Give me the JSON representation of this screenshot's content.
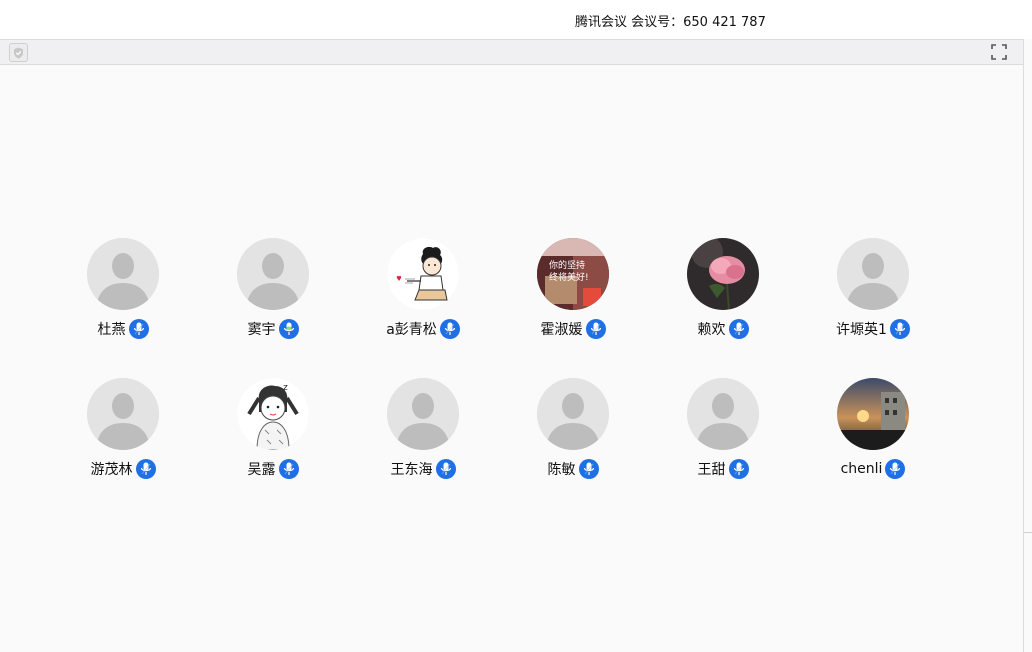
{
  "window": {
    "title": "腾讯会议 会议号：650 421 787"
  },
  "toolbar": {
    "left_icon": "shield-icon",
    "right_icon": "fullscreen-icon"
  },
  "colors": {
    "mic_active": "#1f6fe5",
    "mic_speaking": "#2d9cf0",
    "avatar_placeholder_bg": "#e3e3e3",
    "avatar_placeholder_fg": "#bdbdbd",
    "background": "#fafafa"
  },
  "participants": [
    {
      "name": "杜燕",
      "avatar": "default",
      "mic": "mic-on"
    },
    {
      "name": "窦宇",
      "avatar": "default",
      "mic": "mic-speaking"
    },
    {
      "name": "a彭青松",
      "avatar": "cartoon-boy",
      "mic": "mic-on"
    },
    {
      "name": "霍淑媛",
      "avatar": "photo-text",
      "mic": "mic-on",
      "avatar_text": [
        "你的坚持",
        "终将美好!"
      ]
    },
    {
      "name": "赖欢",
      "avatar": "photo-rose",
      "mic": "mic-on"
    },
    {
      "name": "许塬英1",
      "avatar": "default",
      "mic": "mic-on"
    },
    {
      "name": "游茂林",
      "avatar": "default",
      "mic": "mic-on"
    },
    {
      "name": "吴露",
      "avatar": "sketch-girl",
      "mic": "mic-on",
      "avatar_text": [
        "z"
      ]
    },
    {
      "name": "王东海",
      "avatar": "default",
      "mic": "mic-on"
    },
    {
      "name": "陈敏",
      "avatar": "default",
      "mic": "mic-on"
    },
    {
      "name": "王甜",
      "avatar": "default",
      "mic": "mic-on"
    },
    {
      "name": "chenli",
      "avatar": "photo-sunset",
      "mic": "mic-on"
    }
  ]
}
